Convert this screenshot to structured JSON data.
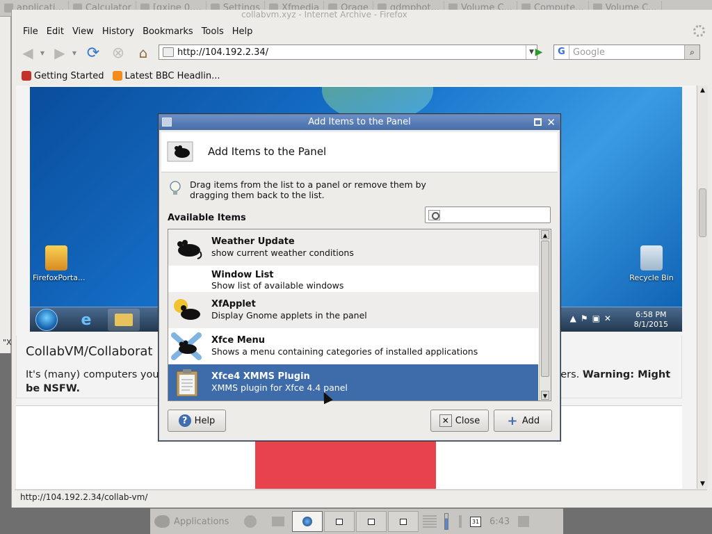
{
  "top_taskbar": {
    "items": [
      "applicati...",
      "Calculator",
      "[gxine 0....",
      "Settings",
      "Xfmedia",
      "Orage",
      "gdmphot...",
      "Volume C...",
      "Compute...",
      "Volume C..."
    ]
  },
  "browser": {
    "title": "collabvm.xyz - Internet Archive - Firefox",
    "menu": [
      "File",
      "Edit",
      "View",
      "History",
      "Bookmarks",
      "Tools",
      "Help"
    ],
    "url": "http://104.192.2.34/",
    "search_engine": "G",
    "search_placeholder": "Google",
    "bookmarks": [
      "Getting Started",
      "Latest BBC Headlin..."
    ],
    "status_text": "http://104.192.2.34/collab-vm/",
    "left_fragment": "\"X"
  },
  "page": {
    "vm": {
      "desktop_icon_left": "FirefoxPorta...",
      "desktop_icon_right": "Recycle Bin",
      "clock_time": "6:58 PM",
      "clock_date": "8/1/2015"
    },
    "heading": "CollabVM/Collaborat",
    "desc_start": "It's (many) computers you",
    "desc_end": "gers.",
    "warning": "Warning: Might",
    "warning_2": "be NSFW."
  },
  "bottom_panel": {
    "apps_label": "Applications",
    "clock": "6:43",
    "calendar_day": "31"
  },
  "dialog": {
    "title": "Add Items to the Panel",
    "header": "Add Items to the Panel",
    "hint": "Drag items from the list to a panel or remove them by dragging them back to the list.",
    "available_label": "Available Items",
    "search_value": "",
    "items": [
      {
        "name": "Weather Update",
        "desc": "show current weather conditions",
        "icon": "mouse-icon"
      },
      {
        "name": "Window List",
        "desc": "Show list of available windows",
        "icon": "none"
      },
      {
        "name": "XfApplet",
        "desc": "Display Gnome applets in the panel",
        "icon": "gnome-foot-mouse-icon"
      },
      {
        "name": "Xfce Menu",
        "desc": "Shows a menu containing categories of installed applications",
        "icon": "xfce-menu-icon"
      },
      {
        "name": "Xfce4 XMMS Plugin",
        "desc": "XMMS plugin for Xfce 4.4 panel",
        "icon": "clipboard-icon"
      }
    ],
    "selected_index": 4,
    "buttons": {
      "help": "Help",
      "close": "Close",
      "add": "Add"
    }
  },
  "colors": {
    "selection": "#3e6cab",
    "titlebar": "#5a7fb8",
    "panel_bg": "#c7c6c2"
  }
}
